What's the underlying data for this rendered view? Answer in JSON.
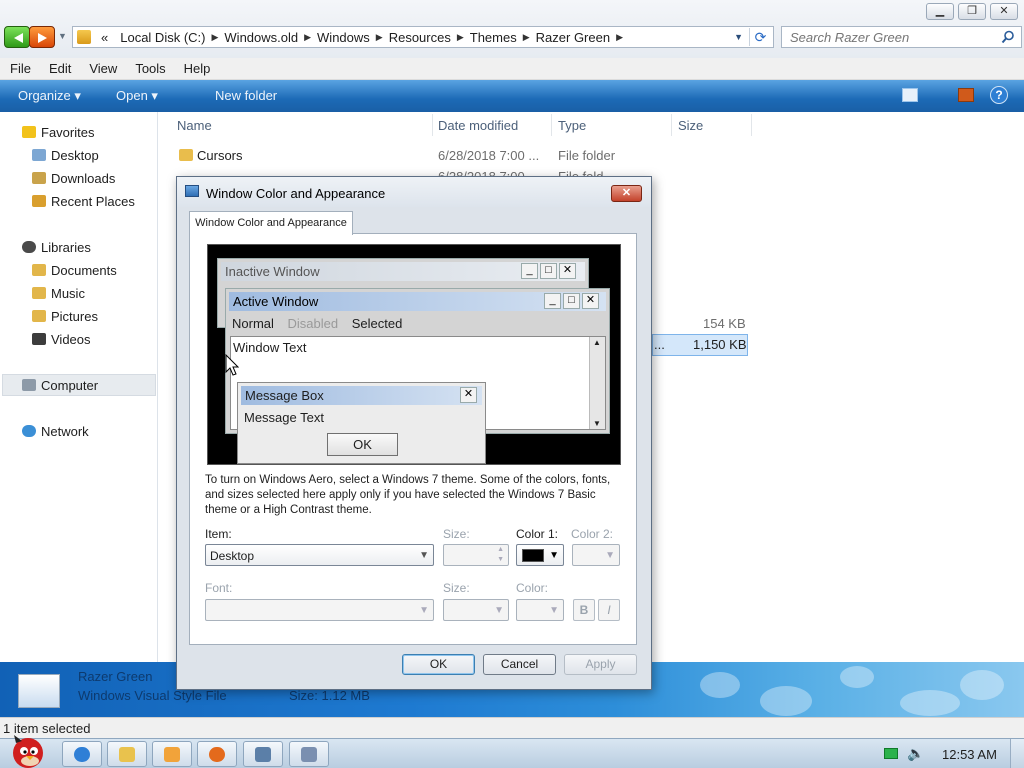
{
  "window": {
    "minimize_icon": "minimize-icon",
    "maximize_icon": "maximize-icon",
    "close_icon": "close-icon"
  },
  "address": {
    "overflow": "«",
    "crumbs": [
      "Local Disk (C:)",
      "Windows.old",
      "Windows",
      "Resources",
      "Themes",
      "Razer Green"
    ]
  },
  "search": {
    "placeholder": "Search Razer Green"
  },
  "menu": [
    "File",
    "Edit",
    "View",
    "Tools",
    "Help"
  ],
  "commands": {
    "organize": "Organize",
    "open": "Open",
    "new_folder": "New folder"
  },
  "nav": {
    "favorites": "Favorites",
    "favorites_items": [
      "Desktop",
      "Downloads",
      "Recent Places"
    ],
    "libraries": "Libraries",
    "libraries_items": [
      "Documents",
      "Music",
      "Pictures",
      "Videos"
    ],
    "computer": "Computer",
    "network": "Network"
  },
  "columns": {
    "name": "Name",
    "date": "Date modified",
    "type": "Type",
    "size": "Size"
  },
  "files": [
    {
      "name": "Cursors",
      "date": "6/28/2018 7:00 ...",
      "type": "File folder",
      "size": ""
    },
    {
      "name": "",
      "date": "6/28/2018 7:00 ...",
      "type": "File fold...",
      "size": ""
    }
  ],
  "visible_sizes": [
    "154 KB",
    "1,150 KB"
  ],
  "selected_partial_name": "...",
  "details": {
    "name": "Razer Green",
    "type": "Windows Visual Style File",
    "size": "Size: 1.12 MB"
  },
  "status": "1 item selected",
  "clock": "12:53 AM",
  "dialog": {
    "title": "Window Color and Appearance",
    "tab": "Window Color and Appearance",
    "preview": {
      "inactive_title": "Inactive Window",
      "active_title": "Active Window",
      "menu_normal": "Normal",
      "menu_disabled": "Disabled",
      "menu_selected": "Selected",
      "window_text": "Window Text",
      "msgbox_title": "Message Box",
      "msgbox_text": "Message Text",
      "msgbox_ok": "OK"
    },
    "description": "To turn on Windows Aero, select a Windows 7 theme.  Some of the colors, fonts, and sizes selected here apply only if you have selected the Windows 7 Basic theme or a High Contrast theme.",
    "labels": {
      "item": "Item:",
      "size": "Size:",
      "color1": "Color 1:",
      "color2": "Color 2:",
      "font": "Font:",
      "font_size": "Size:",
      "font_color": "Color:",
      "bold": "B",
      "italic": "I"
    },
    "item_value": "Desktop",
    "color1_value": "#000000",
    "buttons": {
      "ok": "OK",
      "cancel": "Cancel",
      "apply": "Apply"
    }
  }
}
